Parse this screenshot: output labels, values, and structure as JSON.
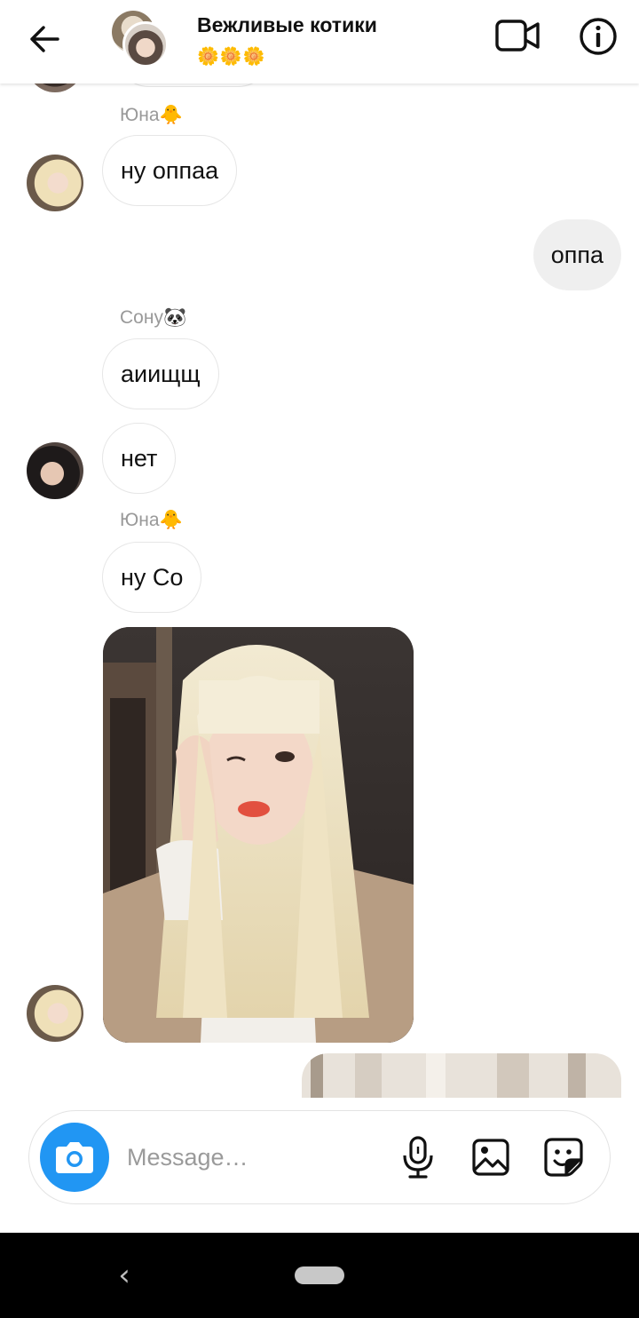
{
  "header": {
    "title": "Вежливые котики",
    "subtitle": "🌼🌼🌼",
    "icons": {
      "back": "back-arrow-icon",
      "video": "video-call-icon",
      "info": "info-icon"
    }
  },
  "messages": [
    {
      "sender": "Юна🐥",
      "text": "ну оппаа",
      "direction": "incoming"
    },
    {
      "text": "оппа",
      "direction": "outgoing"
    },
    {
      "sender": "Сону🐼",
      "text": "аиищщ",
      "direction": "incoming"
    },
    {
      "text": "нет",
      "direction": "incoming"
    },
    {
      "sender": "Юна🐥",
      "text": "ну Со",
      "direction": "incoming"
    },
    {
      "type": "photo",
      "direction": "incoming"
    },
    {
      "type": "photo",
      "direction": "outgoing"
    }
  ],
  "composer": {
    "placeholder": "Message…",
    "icons": {
      "camera": "camera-icon",
      "mic": "microphone-icon",
      "gallery": "gallery-icon",
      "sticker": "sticker-icon"
    }
  },
  "colors": {
    "accent": "#2196f3",
    "outgoing_bubble": "#efefef",
    "incoming_border": "#e6e6e6",
    "secondary_text": "#999999"
  }
}
